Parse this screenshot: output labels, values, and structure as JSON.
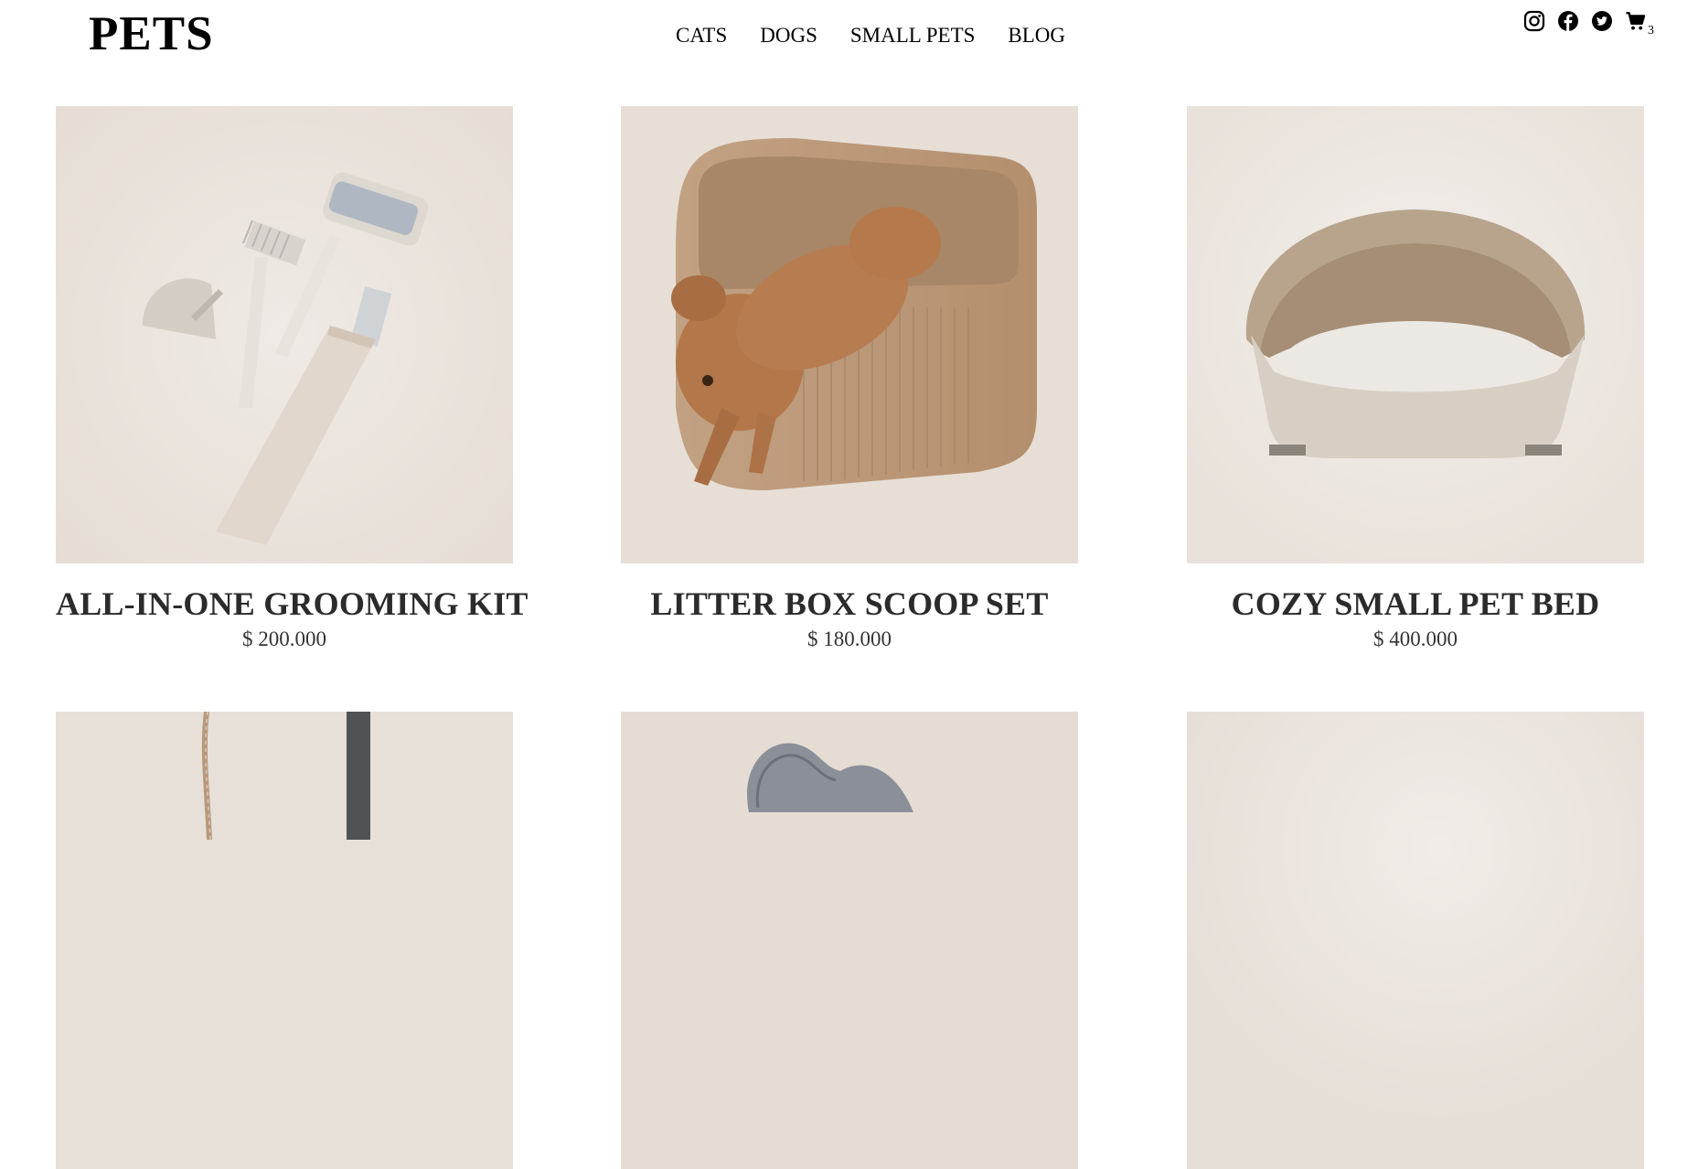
{
  "brand": {
    "logo": "PETS"
  },
  "nav": {
    "items": [
      {
        "label": "CATS"
      },
      {
        "label": "DOGS"
      },
      {
        "label": "SMALL PETS"
      },
      {
        "label": "BLOG"
      }
    ]
  },
  "header_icons": {
    "instagram": "instagram-icon",
    "facebook": "facebook-icon",
    "twitter": "twitter-icon",
    "cart": "cart-icon",
    "cart_count": "3"
  },
  "products": [
    {
      "title": "ALL-IN-ONE GROOMING KIT",
      "price": "$ 200.000",
      "image": "grooming-kit-image"
    },
    {
      "title": "LITTER BOX SCOOP SET",
      "price": "$ 180.000",
      "image": "litter-box-image"
    },
    {
      "title": "COZY SMALL PET BED",
      "price": "$ 400.000",
      "image": "pet-bed-image"
    },
    {
      "title": "",
      "price": "",
      "image": "leash-image"
    },
    {
      "title": "",
      "price": "",
      "image": "pillow-toy-image"
    },
    {
      "title": "",
      "price": "",
      "image": "product-image"
    }
  ],
  "colors": {
    "image_bg": "#e9e3dd",
    "text": "#2b2b2b"
  }
}
